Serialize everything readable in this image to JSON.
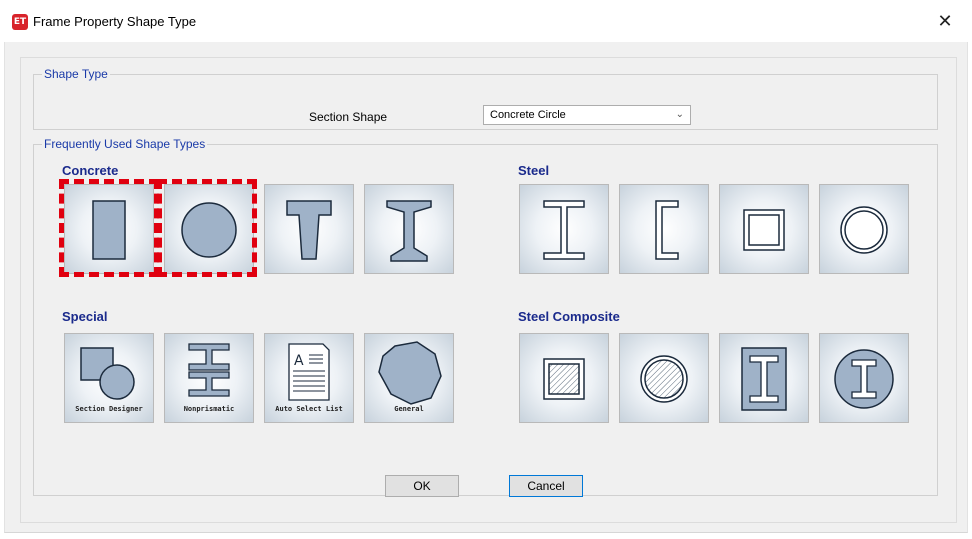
{
  "window": {
    "app_icon_text": "ET",
    "title": "Frame Property Shape Type",
    "close_glyph": "✕"
  },
  "shape_type": {
    "legend": "Shape Type",
    "section_shape_label": "Section Shape",
    "section_shape_value": "Concrete Circle",
    "chevron": "⌵"
  },
  "frequent": {
    "legend": "Frequently Used Shape Types",
    "concrete": {
      "title": "Concrete",
      "items": [
        "concrete-rectangular-icon",
        "concrete-circle-icon",
        "concrete-tee-icon",
        "concrete-i-section-icon"
      ]
    },
    "steel": {
      "title": "Steel",
      "items": [
        "steel-i-wide-flange-icon",
        "steel-channel-icon",
        "steel-tube-icon",
        "steel-pipe-icon"
      ]
    },
    "special": {
      "title": "Special",
      "items": [
        {
          "icon": "section-designer-icon",
          "caption": "Section Designer"
        },
        {
          "icon": "nonprismatic-icon",
          "caption": "Nonprismatic"
        },
        {
          "icon": "auto-select-list-icon",
          "caption": "Auto Select List"
        },
        {
          "icon": "general-icon",
          "caption": "General"
        }
      ]
    },
    "steel_composite": {
      "title": "Steel Composite",
      "items": [
        "filled-steel-tube-icon",
        "filled-steel-pipe-icon",
        "encased-steel-rectangle-icon",
        "encased-steel-circle-icon"
      ]
    }
  },
  "buttons": {
    "ok": "OK",
    "cancel": "Cancel"
  },
  "colors": {
    "shape_fill": "#9fb2c8",
    "shape_stroke": "#1b2a3c",
    "highlight": "#e0000f",
    "heading": "#1a2a8c"
  }
}
